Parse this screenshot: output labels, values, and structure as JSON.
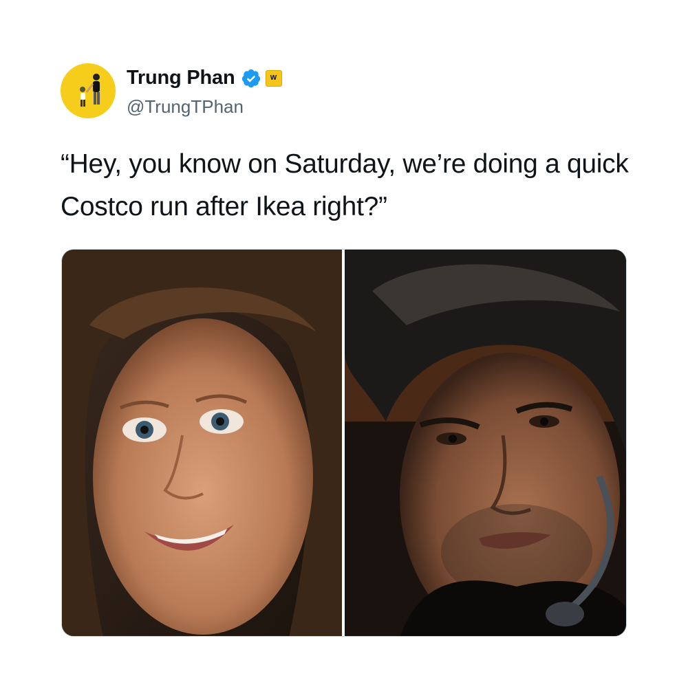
{
  "tweet": {
    "author": {
      "display_name": "Trung Phan",
      "handle": "@TrungTPhan",
      "verified": true,
      "verified_icon": "verified-badge-icon",
      "affiliate_badge_text": "W",
      "avatar_bg": "#f7cd1b"
    },
    "text": "“Hey, you know on Saturday, we’re doing a quick Costco run after Ikea right?”",
    "media": {
      "count": 2,
      "images": [
        {
          "label": "woman-smiling-closeup"
        },
        {
          "label": "man-intense-closeup"
        }
      ]
    }
  },
  "colors": {
    "handle": "#536471",
    "verified_blue": "#1d9bf0",
    "border": "#cfd9de"
  }
}
